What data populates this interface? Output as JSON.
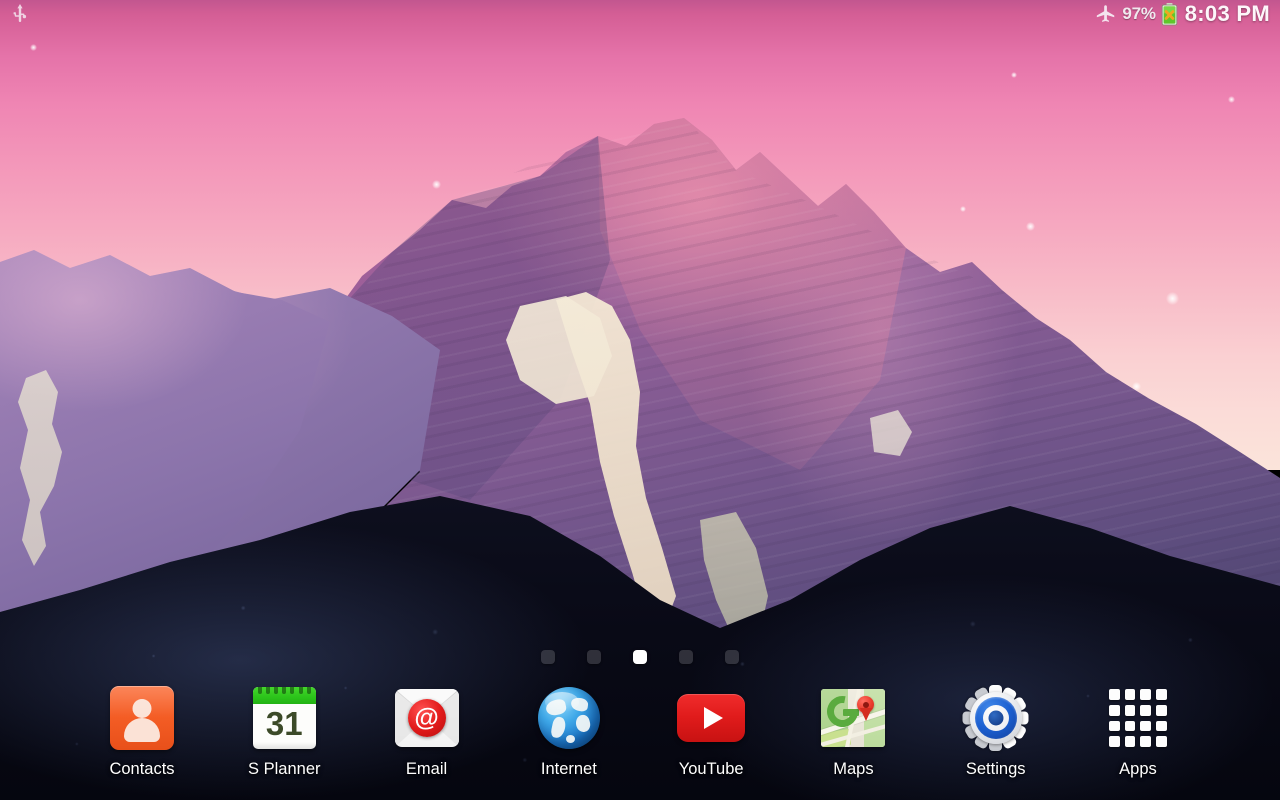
{
  "status_bar": {
    "left_icons": [
      {
        "name": "usb-icon",
        "label": "USB"
      }
    ],
    "right": {
      "airplane_icon": "airplane-mode-icon",
      "battery_percent": "97%",
      "battery_icon": "battery-icon",
      "clock": "8:03 PM"
    }
  },
  "home_screen": {
    "page_indicators": {
      "count": 5,
      "active_index": 2
    }
  },
  "dock": {
    "items": [
      {
        "label": "Contacts",
        "icon": "contacts-icon"
      },
      {
        "label": "S Planner",
        "icon": "calendar-icon",
        "day": "31"
      },
      {
        "label": "Email",
        "icon": "email-icon",
        "glyph": "@"
      },
      {
        "label": "Internet",
        "icon": "globe-icon"
      },
      {
        "label": "YouTube",
        "icon": "youtube-icon"
      },
      {
        "label": "Maps",
        "icon": "maps-icon"
      },
      {
        "label": "Settings",
        "icon": "gear-icon"
      },
      {
        "label": "Apps",
        "icon": "apps-grid-icon"
      }
    ]
  },
  "wallpaper": {
    "description": "Mountain at sunset with pink sky",
    "colors": {
      "sky_top": "#c2568f",
      "sky_horizon": "#fbe4da",
      "mountain_sunlit": "#d9719a",
      "mountain_shadow": "#5d4d7e",
      "snow": "#fdf6e2",
      "foreground_rock": "#0a0b18"
    }
  }
}
